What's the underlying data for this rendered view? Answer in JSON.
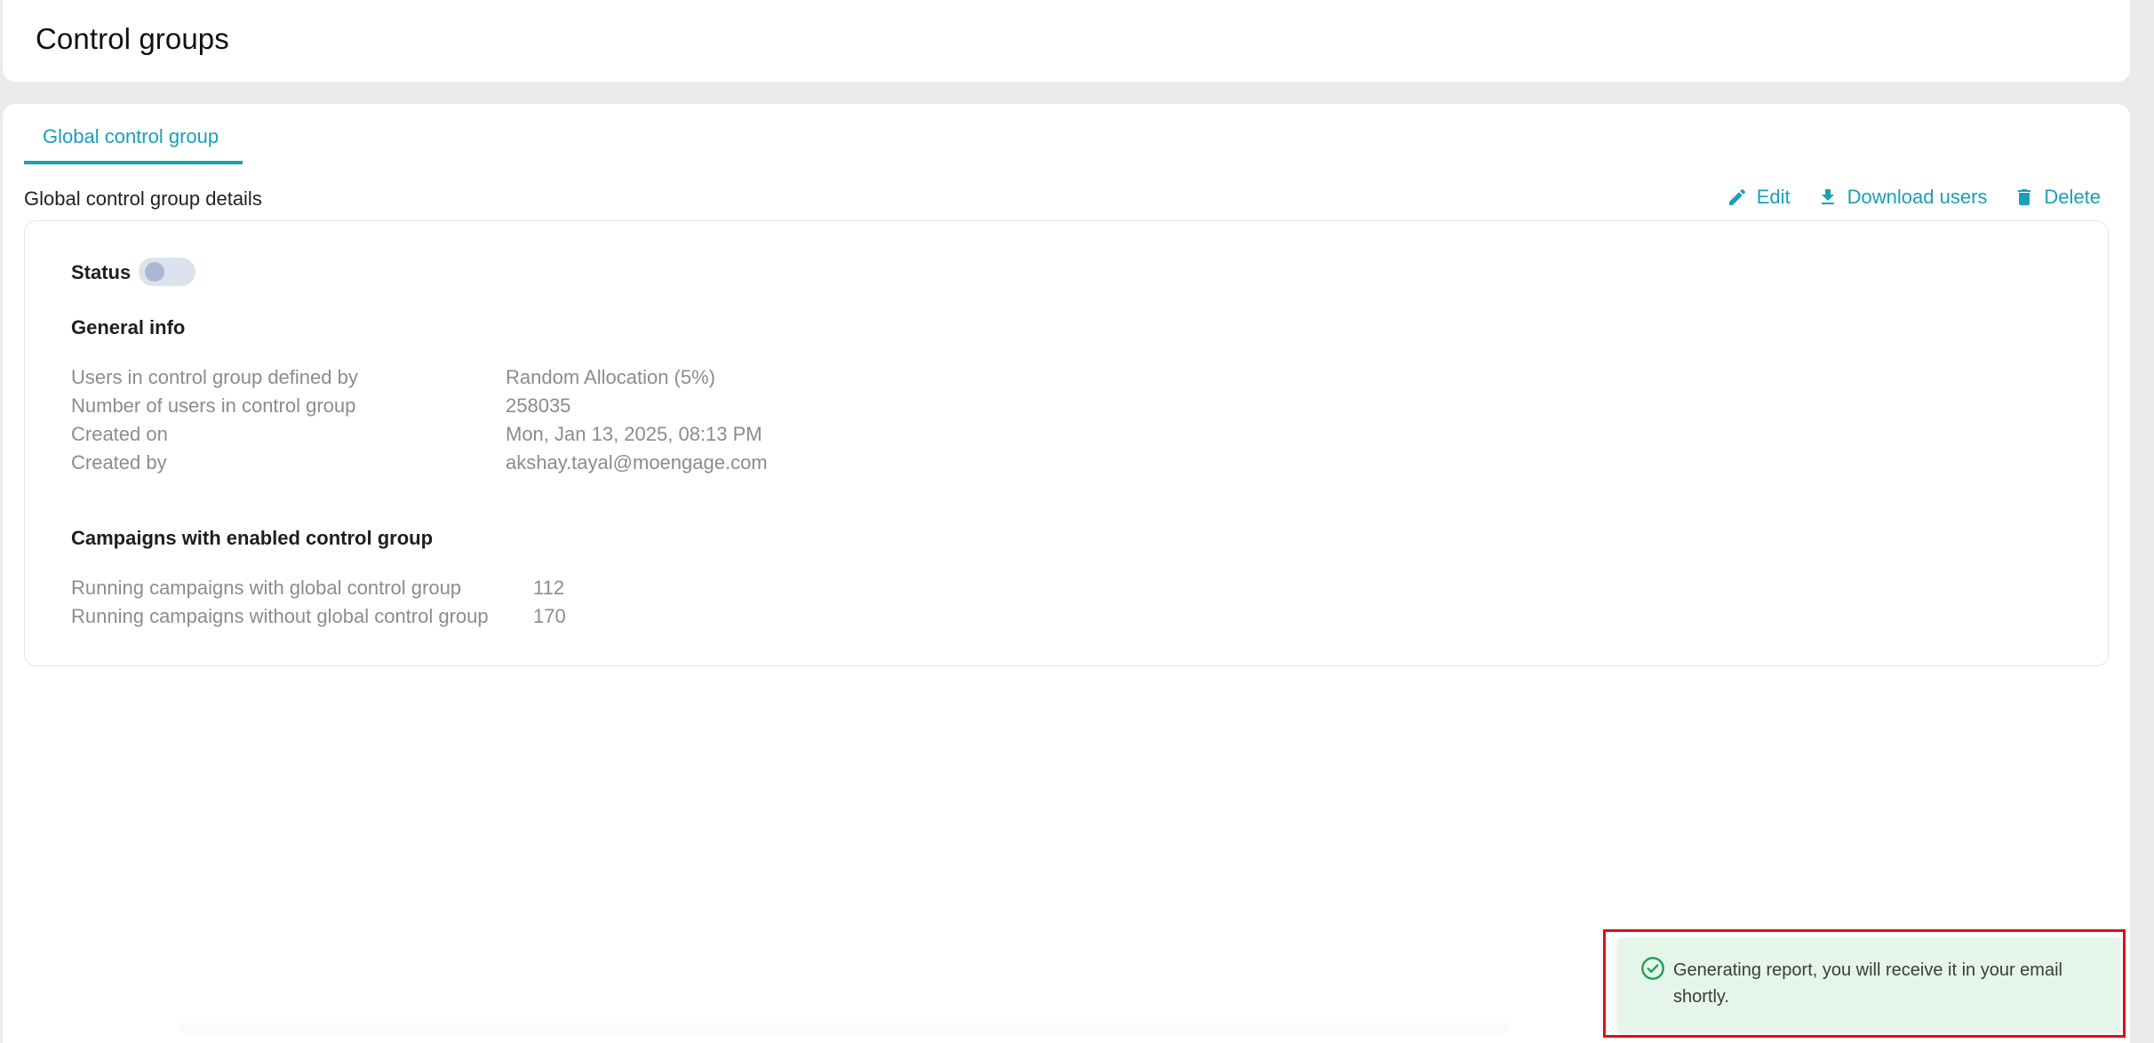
{
  "header": {
    "title": "Control groups"
  },
  "tabs": [
    {
      "label": "Global control group",
      "active": true
    }
  ],
  "details": {
    "section_title": "Global control group details",
    "actions": {
      "edit": {
        "label": "Edit",
        "icon": "pencil-icon"
      },
      "download": {
        "label": "Download users",
        "icon": "download-icon"
      },
      "delete": {
        "label": "Delete",
        "icon": "trash-icon"
      }
    },
    "status": {
      "label": "Status",
      "enabled": false
    },
    "general_info": {
      "heading": "General info",
      "rows": [
        {
          "key": "Users in control group defined by",
          "value": "Random Allocation (5%)"
        },
        {
          "key": "Number of users in control group",
          "value": "258035"
        },
        {
          "key": "Created on",
          "value": "Mon, Jan 13, 2025, 08:13 PM"
        },
        {
          "key": "Created by",
          "value": "akshay.tayal@moengage.com"
        }
      ]
    },
    "campaigns": {
      "heading": "Campaigns with enabled control group",
      "rows": [
        {
          "key": "Running campaigns with global control group",
          "value": "112"
        },
        {
          "key": "Running campaigns without global control group",
          "value": "170"
        }
      ]
    }
  },
  "toast": {
    "icon": "check-circle-icon",
    "message": "Generating report, you will receive it in your email shortly."
  },
  "colors": {
    "accent": "#1a9fb8",
    "success_bg": "#e6f5ea",
    "success_icon": "#1f9d55",
    "highlight": "#d9101b"
  }
}
